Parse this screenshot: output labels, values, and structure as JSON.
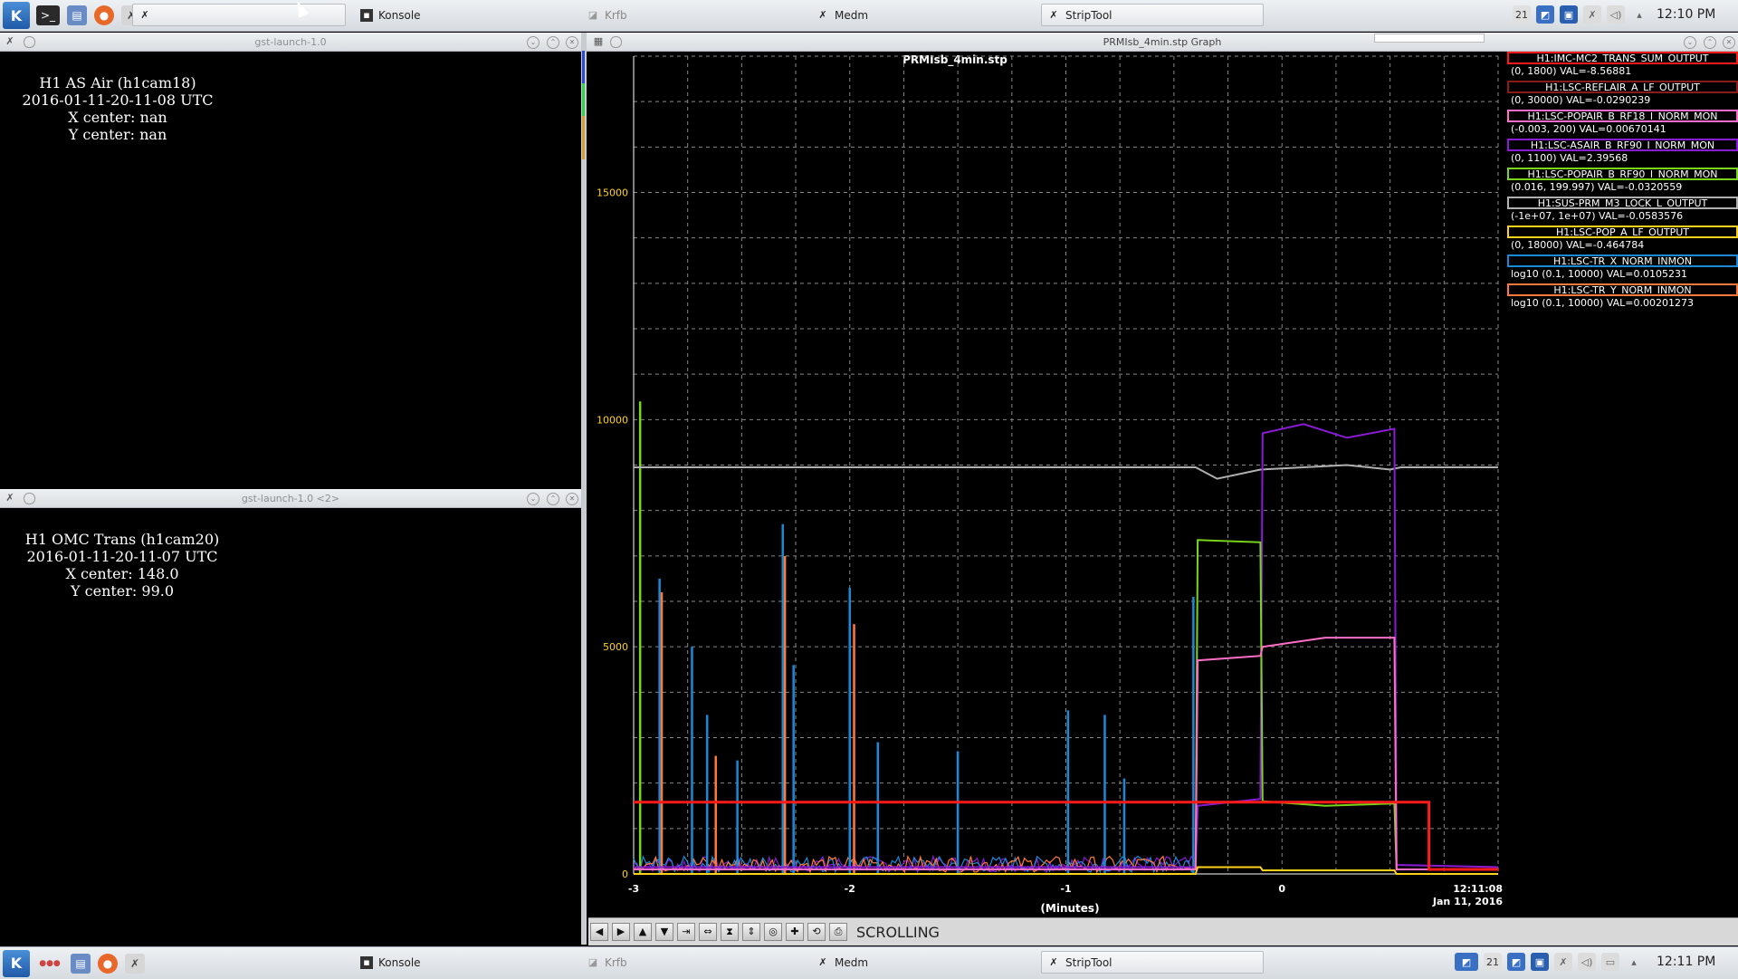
{
  "taskbar_top": {
    "tasks": [
      {
        "label": "",
        "icon": "striptool-icon"
      },
      {
        "label": "Konsole",
        "icon": "konsole-icon"
      },
      {
        "label": "Krfb",
        "icon": "krfb-icon"
      },
      {
        "label": "Medm",
        "icon": "medm-icon"
      },
      {
        "label": "StripTool",
        "icon": "striptool-icon"
      }
    ],
    "tray_number": "21",
    "clock": "12:10 PM"
  },
  "taskbar_bottom": {
    "tasks": [
      {
        "label": "Konsole",
        "icon": "konsole-icon"
      },
      {
        "label": "Krfb",
        "icon": "krfb-icon"
      },
      {
        "label": "Medm",
        "icon": "medm-icon"
      },
      {
        "label": "StripTool",
        "icon": "striptool-icon"
      }
    ],
    "tray_number": "21",
    "clock": "12:11 PM"
  },
  "cam_window_1": {
    "title": "gst-launch-1.0",
    "lines": [
      "H1 AS Air (h1cam18)",
      "2016-01-11-20-11-08 UTC",
      "X center: nan",
      "Y center: nan"
    ]
  },
  "cam_window_2": {
    "title": "gst-launch-1.0 <2>",
    "lines": [
      "H1 OMC Trans (h1cam20)",
      "2016-01-11-20-11-07 UTC",
      "X center: 148.0",
      "Y center: 99.0"
    ]
  },
  "strip_window": {
    "title": "PRMIsb_4min.stp Graph",
    "plot_title": "PRMIsb_4min.stp",
    "status": "SCROLLING"
  },
  "legend": [
    {
      "name": "H1:IMC-MC2_TRANS_SUM_OUTPUT",
      "value": "(0, 1800) VAL=-8.56881",
      "color": "#ff1a1a"
    },
    {
      "name": "H1:LSC-REFLAIR_A_LF_OUTPUT",
      "value": "(0, 30000) VAL=-0.0290239",
      "color": "#8b1a1a"
    },
    {
      "name": "H1:LSC-POPAIR_B_RF18_I_NORM_MON",
      "value": "(-0.003, 200) VAL=0.00670141",
      "color": "#ff6ec7"
    },
    {
      "name": "H1:LSC-ASAIR_B_RF90_I_NORM_MON",
      "value": "(0, 1100) VAL=2.39568",
      "color": "#8a1ad6"
    },
    {
      "name": "H1:LSC-POPAIR_B_RF90_I_NORM_MON",
      "value": "(0.016, 199.997) VAL=-0.0320559",
      "color": "#7ad61a"
    },
    {
      "name": "H1:SUS-PRM_M3_LOCK_L_OUTPUT",
      "value": "(-1e+07, 1e+07) VAL=-0.0583576",
      "color": "#b0b0b0"
    },
    {
      "name": "H1:LSC-POP_A_LF_OUTPUT",
      "value": "(0, 18000) VAL=-0.464784",
      "color": "#ffd21a"
    },
    {
      "name": "H1:LSC-TR_X_NORM_INMON",
      "value": "log10 (0.1, 10000) VAL=0.0105231",
      "color": "#1a8ad6"
    },
    {
      "name": "H1:LSC-TR_Y_NORM_INMON",
      "value": "log10 (0.1, 10000) VAL=0.00201273",
      "color": "#ff7a3a"
    }
  ],
  "chart_data": {
    "type": "line",
    "title": "PRMIsb_4min.stp",
    "xlabel": "(Minutes)",
    "ylabel": "",
    "x_ticks": [
      "-3",
      "-2",
      "-1",
      "0"
    ],
    "x_end_label": [
      "12:11:08",
      "Jan 11, 2016"
    ],
    "y_ticks": [
      "0",
      "5000",
      "10000",
      "15000"
    ],
    "xlim": [
      -3,
      1
    ],
    "ylim": [
      0,
      18000
    ],
    "grid": true,
    "series": [
      {
        "name": "H1:SUS-PRM_M3_LOCK_L_OUTPUT",
        "color": "#b0b0b0",
        "x": [
          -3,
          -2.0,
          -1.0,
          -0.4,
          -0.3,
          -0.1,
          0.1,
          0.3,
          0.5,
          0.55,
          1.0
        ],
        "y": [
          8950,
          8950,
          8950,
          8950,
          8700,
          8900,
          8950,
          9000,
          8900,
          8950,
          8950
        ]
      },
      {
        "name": "H1:LSC-ASAIR_B_RF90_I_NORM_MON",
        "color": "#8a1ad6",
        "x": [
          -3,
          -0.4,
          -0.39,
          -0.1,
          -0.09,
          0.1,
          0.3,
          0.52,
          0.53,
          1.0
        ],
        "y": [
          150,
          150,
          1500,
          1650,
          9700,
          9900,
          9600,
          9800,
          200,
          150
        ]
      },
      {
        "name": "H1:LSC-POPAIR_B_RF90_I_NORM_MON",
        "color": "#7ad61a",
        "x": [
          -3,
          -0.4,
          -0.39,
          -0.1,
          -0.09,
          0.2,
          0.52,
          0.53,
          1.0
        ],
        "y": [
          100,
          100,
          7350,
          7300,
          1600,
          1500,
          1550,
          100,
          100
        ]
      },
      {
        "name": "H1:LSC-POPAIR_B_RF18_I_NORM_MON",
        "color": "#ff6ec7",
        "x": [
          -3,
          -0.4,
          -0.39,
          -0.1,
          -0.09,
          0.2,
          0.52,
          0.53,
          1.0
        ],
        "y": [
          100,
          100,
          4700,
          4800,
          5000,
          5200,
          5200,
          100,
          100
        ]
      },
      {
        "name": "H1:IMC-MC2_TRANS_SUM_OUTPUT",
        "color": "#ff1a1a",
        "x": [
          -3,
          0.68,
          0.68,
          1.0
        ],
        "y": [
          1580,
          1580,
          100,
          100
        ]
      },
      {
        "name": "H1:LSC-POP_A_LF_OUTPUT",
        "color": "#ffd21a",
        "x": [
          -3,
          -0.4,
          -0.39,
          -0.1,
          -0.09,
          0.52,
          0.53,
          1.0
        ],
        "y": [
          0,
          0,
          150,
          150,
          80,
          80,
          0,
          0
        ]
      }
    ],
    "spikes": [
      {
        "x": -2.97,
        "y": 10400,
        "color": "#7ad61a"
      },
      {
        "x": -2.88,
        "y": 6500,
        "color": "#1a8ad6"
      },
      {
        "x": -2.87,
        "y": 6200,
        "color": "#ff7a3a"
      },
      {
        "x": -2.73,
        "y": 5000,
        "color": "#1a8ad6"
      },
      {
        "x": -2.66,
        "y": 3500,
        "color": "#1a8ad6"
      },
      {
        "x": -2.62,
        "y": 2600,
        "color": "#ff7a3a"
      },
      {
        "x": -2.52,
        "y": 2500,
        "color": "#1a8ad6"
      },
      {
        "x": -2.31,
        "y": 7700,
        "color": "#1a8ad6"
      },
      {
        "x": -2.3,
        "y": 7000,
        "color": "#ff7a3a"
      },
      {
        "x": -2.26,
        "y": 4600,
        "color": "#1a8ad6"
      },
      {
        "x": -2.0,
        "y": 6300,
        "color": "#1a8ad6"
      },
      {
        "x": -1.98,
        "y": 5500,
        "color": "#ff7a3a"
      },
      {
        "x": -1.87,
        "y": 2900,
        "color": "#1a8ad6"
      },
      {
        "x": -1.5,
        "y": 2700,
        "color": "#1a8ad6"
      },
      {
        "x": -0.99,
        "y": 3600,
        "color": "#1a8ad6"
      },
      {
        "x": -0.82,
        "y": 3500,
        "color": "#1a8ad6"
      },
      {
        "x": -0.73,
        "y": 2100,
        "color": "#1a8ad6"
      },
      {
        "x": -0.41,
        "y": 6100,
        "color": "#1a8ad6"
      }
    ]
  }
}
